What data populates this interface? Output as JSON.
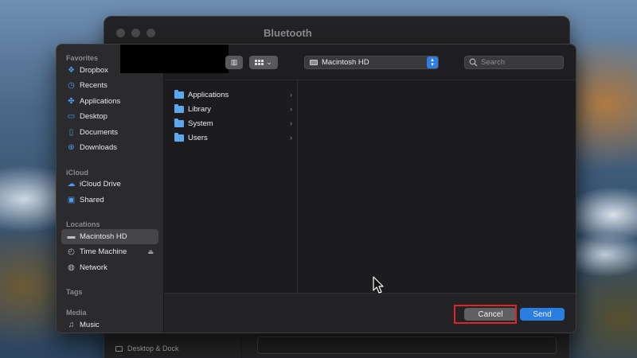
{
  "background_window": {
    "title": "Bluetooth",
    "sidebar_item_label": "Desktop & Dock"
  },
  "dialog": {
    "sidebar": {
      "sections": [
        {
          "title": "Favorites",
          "items": [
            {
              "label": "Dropbox",
              "icon": "dropbox-icon"
            },
            {
              "label": "Recents",
              "icon": "clock-icon"
            },
            {
              "label": "Applications",
              "icon": "applications-icon"
            },
            {
              "label": "Desktop",
              "icon": "desktop-icon"
            },
            {
              "label": "Documents",
              "icon": "document-icon"
            },
            {
              "label": "Downloads",
              "icon": "download-icon"
            }
          ]
        },
        {
          "title": "iCloud",
          "items": [
            {
              "label": "iCloud Drive",
              "icon": "cloud-icon"
            },
            {
              "label": "Shared",
              "icon": "shared-folder-icon"
            }
          ]
        },
        {
          "title": "Locations",
          "items": [
            {
              "label": "Macintosh HD",
              "icon": "drive-icon",
              "selected": true
            },
            {
              "label": "Time Machine",
              "icon": "time-machine-icon"
            },
            {
              "label": "Network",
              "icon": "globe-icon"
            }
          ]
        },
        {
          "title": "Tags",
          "items": []
        },
        {
          "title": "Media",
          "items": [
            {
              "label": "Music",
              "icon": "music-note-icon"
            }
          ]
        }
      ]
    },
    "toolbar": {
      "location_label": "Macintosh HD",
      "search_placeholder": "Search"
    },
    "column_items": [
      {
        "label": "Applications"
      },
      {
        "label": "Library"
      },
      {
        "label": "System"
      },
      {
        "label": "Users"
      }
    ],
    "buttons": {
      "cancel_label": "Cancel",
      "send_label": "Send"
    }
  },
  "colors": {
    "accent": "#2a7de1",
    "folder": "#5aa9ef",
    "highlight": "#e0242c"
  }
}
